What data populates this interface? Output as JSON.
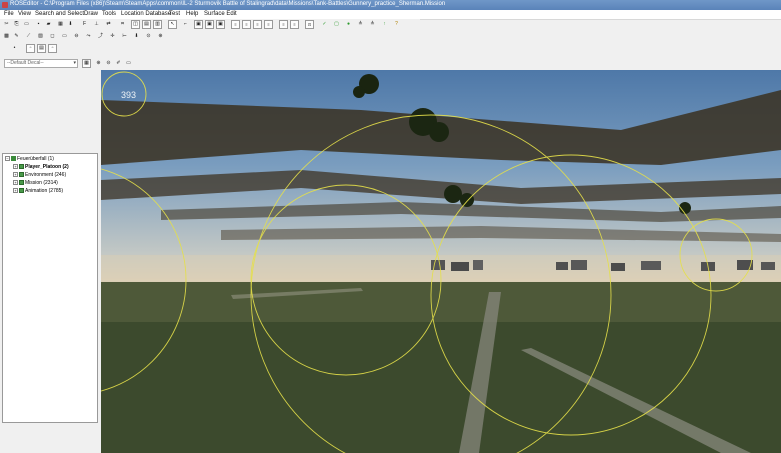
{
  "window": {
    "title": "ROSEditor - C:\\Program Files (x86)\\Steam\\SteamApps\\common\\IL-2 Sturmovik Battle of Stalingrad\\data\\Missions\\Tank-Battles\\Gunnery_practice_Sherman.Mission"
  },
  "menu": [
    "File",
    "View",
    "Search and Select",
    "Draw",
    "Tools",
    "Location Database",
    "Test",
    "Help",
    "Surface Edit"
  ],
  "toolbar_row3": {
    "decal_select": "--Default Decal--"
  },
  "tree": {
    "root": "Feuerüberfall (1)",
    "children": [
      {
        "label": "Player_Platoon (2)",
        "bold": true
      },
      {
        "label": "Environment (246)",
        "bold": false
      },
      {
        "label": "Mission (2314)",
        "bold": false
      },
      {
        "label": "Animation (2785)",
        "bold": false
      }
    ]
  },
  "viewport": {
    "hud_value": "393"
  },
  "colors": {
    "title_bar": "#5a83b9",
    "selection_circle": "#e5e04a",
    "tree_icon_green": "#3a8a3a"
  }
}
